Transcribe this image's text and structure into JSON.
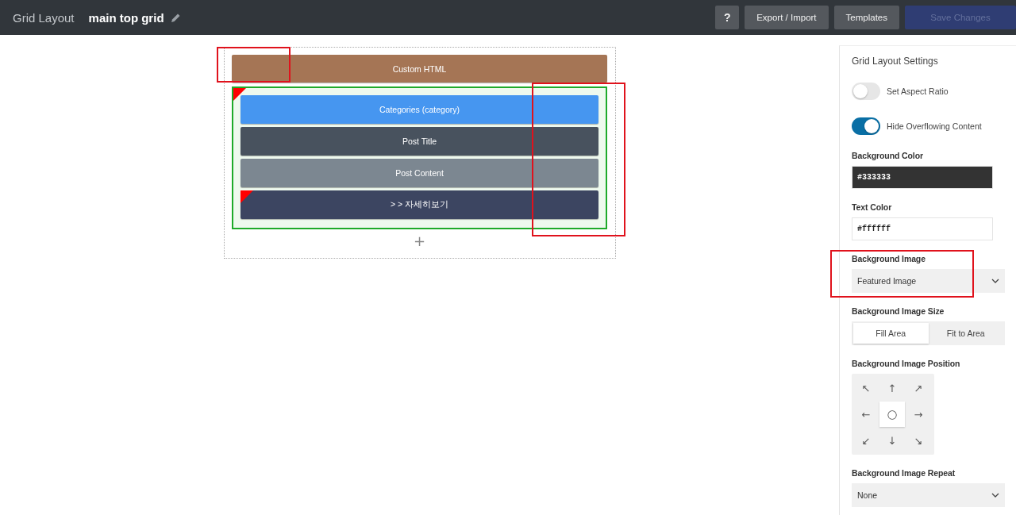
{
  "header": {
    "app_title": "Grid Layout",
    "layout_name": "main top grid",
    "buttons": [
      {
        "kind": "help",
        "label": "?",
        "disabled": false
      },
      {
        "kind": "plain",
        "label": "Export / Import",
        "disabled": false
      },
      {
        "kind": "plain",
        "label": "Templates",
        "disabled": false
      },
      {
        "kind": "primary",
        "label": "Save Changes",
        "disabled": true
      }
    ]
  },
  "canvas": {
    "blocks": [
      {
        "kind": "element",
        "label": "Custom HTML",
        "color": "#a57555",
        "marked": false
      },
      {
        "kind": "group",
        "selected": true,
        "marked": true,
        "children": [
          {
            "kind": "element",
            "label": "Categories (category)",
            "color": "#4696f0",
            "marked": false
          },
          {
            "kind": "element",
            "label": "Post Title",
            "color": "#48525e",
            "marked": false
          },
          {
            "kind": "element",
            "label": "Post Content",
            "color": "#7c8791",
            "marked": false
          },
          {
            "kind": "element",
            "label": "> > 자세히보기",
            "color": "#3c4561",
            "marked": true
          }
        ]
      }
    ],
    "add_button": "+"
  },
  "annotations": [
    {
      "kind": "corner"
    },
    {
      "kind": "right_edge"
    },
    {
      "kind": "background_image"
    }
  ],
  "panel": {
    "title": "Grid Layout Settings",
    "sections": [
      {
        "kind": "toggle",
        "label": "Set Aspect Ratio",
        "on": false
      },
      {
        "kind": "toggle",
        "label": "Hide Overflowing Content",
        "on": true
      },
      {
        "kind": "color",
        "label": "Background Color",
        "value": "#333333"
      },
      {
        "kind": "color",
        "label": "Text Color",
        "value": "#ffffff"
      },
      {
        "kind": "select",
        "label": "Background Image",
        "value": "Featured Image"
      },
      {
        "kind": "segmented",
        "label": "Background Image Size",
        "options": [
          {
            "label": "Fill Area",
            "selected": true
          },
          {
            "label": "Fit to Area",
            "selected": false
          }
        ]
      },
      {
        "kind": "position",
        "label": "Background Image Position",
        "cells": [
          {
            "glyph": "↖",
            "selected": false
          },
          {
            "glyph": "↑",
            "selected": false
          },
          {
            "glyph": "↗",
            "selected": false
          },
          {
            "glyph": "←",
            "selected": false
          },
          {
            "glyph": "○",
            "selected": true
          },
          {
            "glyph": "→",
            "selected": false
          },
          {
            "glyph": "↙",
            "selected": false
          },
          {
            "glyph": "↓",
            "selected": false
          },
          {
            "glyph": "↘",
            "selected": false
          }
        ]
      },
      {
        "kind": "select",
        "label": "Background Image Repeat",
        "value": "None"
      }
    ]
  }
}
